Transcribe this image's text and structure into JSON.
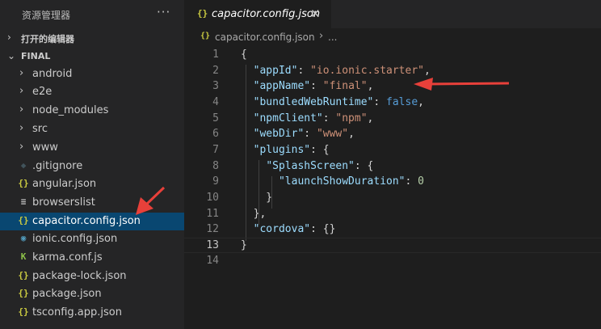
{
  "explorer": {
    "title": "资源管理器",
    "more": "···",
    "open_editors_label": "打开的编辑器",
    "folder_label": "FINAL",
    "items": [
      {
        "label": "android",
        "kind": "folder"
      },
      {
        "label": "e2e",
        "kind": "folder"
      },
      {
        "label": "node_modules",
        "kind": "folder"
      },
      {
        "label": "src",
        "kind": "folder"
      },
      {
        "label": "www",
        "kind": "folder"
      },
      {
        "label": ".gitignore",
        "kind": "file",
        "icon": "gitignore-icon"
      },
      {
        "label": "angular.json",
        "kind": "file",
        "icon": "json-icon"
      },
      {
        "label": "browserslist",
        "kind": "file",
        "icon": "text-file-icon"
      },
      {
        "label": "capacitor.config.json",
        "kind": "file",
        "icon": "json-icon",
        "selected": true
      },
      {
        "label": "ionic.config.json",
        "kind": "file",
        "icon": "ionic-icon"
      },
      {
        "label": "karma.conf.js",
        "kind": "file",
        "icon": "karma-icon"
      },
      {
        "label": "package-lock.json",
        "kind": "file",
        "icon": "json-icon"
      },
      {
        "label": "package.json",
        "kind": "file",
        "icon": "json-icon"
      },
      {
        "label": "tsconfig.app.json",
        "kind": "file",
        "icon": "json-icon"
      }
    ]
  },
  "editor": {
    "tab_label": "capacitor.config.json",
    "tab_icon": "{}",
    "breadcrumb_file": "capacitor.config.json",
    "breadcrumb_more": "...",
    "active_line": 13,
    "line_numbers": [
      "1",
      "2",
      "3",
      "4",
      "5",
      "6",
      "7",
      "8",
      "9",
      "10",
      "11",
      "12",
      "13",
      "14"
    ],
    "code": {
      "open": "{",
      "appId_key": "\"appId\"",
      "appId_val": "\"io.ionic.starter\"",
      "appName_key": "\"appName\"",
      "appName_val": "\"final\"",
      "bundled_key": "\"bundledWebRuntime\"",
      "bundled_val": "false",
      "npm_key": "\"npmClient\"",
      "npm_val": "\"npm\"",
      "webdir_key": "\"webDir\"",
      "webdir_val": "\"www\"",
      "plugins_key": "\"plugins\"",
      "splash_key": "\"SplashScreen\"",
      "launch_key": "\"launchShowDuration\"",
      "launch_val": "0",
      "cordova_key": "\"cordova\"",
      "cordova_val": "{}",
      "close": "}"
    }
  },
  "colors": {
    "annotation_arrow": "#e8403a",
    "selection": "#094771",
    "json_icon": "#cbcb41"
  }
}
